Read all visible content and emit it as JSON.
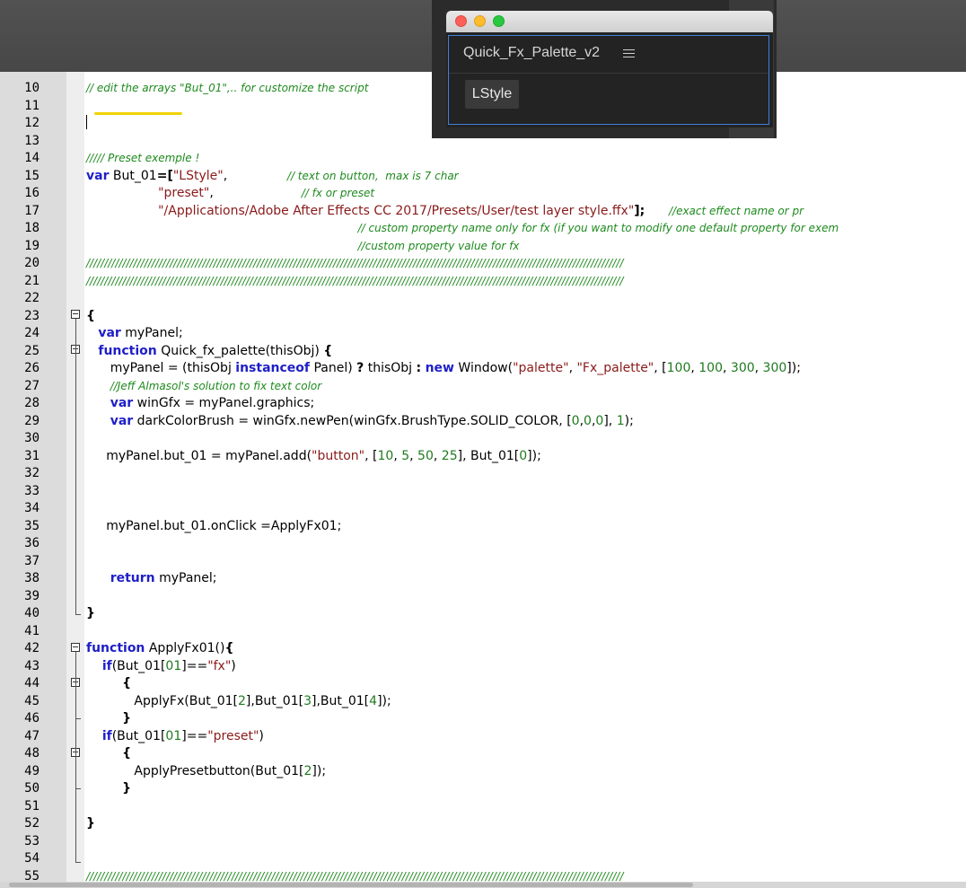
{
  "panel": {
    "title": "Quick_Fx_Palette_v2",
    "menu_icon": "hamburger-menu-icon",
    "button_label": "LStyle",
    "accent_color": "#3f80d8"
  },
  "editor": {
    "lines": [
      {
        "n": "10",
        "tokens": [
          {
            "t": "// edit the arrays \"But_01\",.. for customize the script",
            "c": "t-cm"
          }
        ]
      },
      {
        "n": "11",
        "tokens": []
      },
      {
        "n": "12",
        "tokens": []
      },
      {
        "n": "13",
        "tokens": []
      },
      {
        "n": "14",
        "tokens": [
          {
            "t": "///// Preset exemple !",
            "c": "t-cm"
          }
        ]
      },
      {
        "n": "15",
        "tokens": [
          {
            "t": "var",
            "c": "t-kw"
          },
          {
            "t": " But_01"
          },
          {
            "t": "=[",
            "c": "t-op"
          },
          {
            "t": "\"LStyle\"",
            "c": "t-str"
          },
          {
            "t": ",               "
          },
          {
            "t": "// text on button,  max is 7 char",
            "c": "t-cm"
          }
        ]
      },
      {
        "n": "16",
        "tokens": [
          {
            "t": "                  "
          },
          {
            "t": "\"preset\"",
            "c": "t-str"
          },
          {
            "t": ",                      "
          },
          {
            "t": "// fx or preset",
            "c": "t-cm"
          }
        ]
      },
      {
        "n": "17",
        "tokens": [
          {
            "t": "                  "
          },
          {
            "t": "\"/Applications/Adobe After Effects CC 2017/Presets/User/test layer style.ffx\"",
            "c": "t-str"
          },
          {
            "t": "];",
            "c": "t-op"
          },
          {
            "t": "      "
          },
          {
            "t": "//exact effect name or pr",
            "c": "t-cm"
          }
        ]
      },
      {
        "n": "18",
        "tokens": [
          {
            "t": "                                                                    "
          },
          {
            "t": "// custom property name only for fx (if you want to modify one default property for exem",
            "c": "t-cm"
          }
        ]
      },
      {
        "n": "19",
        "tokens": [
          {
            "t": "                                                                    "
          },
          {
            "t": "//custom property value for fx",
            "c": "t-cm"
          }
        ]
      },
      {
        "n": "20",
        "tokens": [
          {
            "t": "////////////////////////////////////////////////////////////////////////////////////////////////////////////////////////////////////////////////////",
            "c": "t-cm"
          }
        ]
      },
      {
        "n": "21",
        "tokens": [
          {
            "t": "////////////////////////////////////////////////////////////////////////////////////////////////////////////////////////////////////////////////////",
            "c": "t-cm"
          }
        ]
      },
      {
        "n": "22",
        "tokens": []
      },
      {
        "n": "23",
        "tokens": [
          {
            "t": "{",
            "c": "t-op"
          }
        ]
      },
      {
        "n": "24",
        "tokens": [
          {
            "t": "   "
          },
          {
            "t": "var",
            "c": "t-kw"
          },
          {
            "t": " myPanel;"
          }
        ]
      },
      {
        "n": "25",
        "tokens": [
          {
            "t": "   "
          },
          {
            "t": "function",
            "c": "t-kw"
          },
          {
            "t": " Quick_fx_palette(thisObj) "
          },
          {
            "t": "{",
            "c": "t-op"
          }
        ]
      },
      {
        "n": "26",
        "tokens": [
          {
            "t": "      myPanel = (thisObj "
          },
          {
            "t": "instanceof",
            "c": "t-kw"
          },
          {
            "t": " Panel) "
          },
          {
            "t": "?",
            "c": "t-op"
          },
          {
            "t": " thisObj "
          },
          {
            "t": ":",
            "c": "t-op"
          },
          {
            "t": " "
          },
          {
            "t": "new",
            "c": "t-kw"
          },
          {
            "t": " Window("
          },
          {
            "t": "\"palette\"",
            "c": "t-str"
          },
          {
            "t": ", "
          },
          {
            "t": "\"Fx_palette\"",
            "c": "t-str"
          },
          {
            "t": ", ["
          },
          {
            "t": "100",
            "c": "t-num"
          },
          {
            "t": ", "
          },
          {
            "t": "100",
            "c": "t-num"
          },
          {
            "t": ", "
          },
          {
            "t": "300",
            "c": "t-num"
          },
          {
            "t": ", "
          },
          {
            "t": "300",
            "c": "t-num"
          },
          {
            "t": "]);"
          }
        ]
      },
      {
        "n": "27",
        "tokens": [
          {
            "t": "      "
          },
          {
            "t": "//Jeff Almasol's solution to fix text color",
            "c": "t-cm"
          }
        ]
      },
      {
        "n": "28",
        "tokens": [
          {
            "t": "      "
          },
          {
            "t": "var",
            "c": "t-kw"
          },
          {
            "t": " winGfx = myPanel.graphics;"
          }
        ]
      },
      {
        "n": "29",
        "tokens": [
          {
            "t": "      "
          },
          {
            "t": "var",
            "c": "t-kw"
          },
          {
            "t": " darkColorBrush = winGfx.newPen(winGfx.BrushType.SOLID_COLOR, ["
          },
          {
            "t": "0",
            "c": "t-num"
          },
          {
            "t": ","
          },
          {
            "t": "0",
            "c": "t-num"
          },
          {
            "t": ","
          },
          {
            "t": "0",
            "c": "t-num"
          },
          {
            "t": "], "
          },
          {
            "t": "1",
            "c": "t-num"
          },
          {
            "t": ");"
          }
        ]
      },
      {
        "n": "30",
        "tokens": []
      },
      {
        "n": "31",
        "tokens": [
          {
            "t": "     myPanel.but_01 = myPanel.add("
          },
          {
            "t": "\"button\"",
            "c": "t-str"
          },
          {
            "t": ", ["
          },
          {
            "t": "10",
            "c": "t-num"
          },
          {
            "t": ", "
          },
          {
            "t": "5",
            "c": "t-num"
          },
          {
            "t": ", "
          },
          {
            "t": "50",
            "c": "t-num"
          },
          {
            "t": ", "
          },
          {
            "t": "25",
            "c": "t-num"
          },
          {
            "t": "], But_01["
          },
          {
            "t": "0",
            "c": "t-num"
          },
          {
            "t": "]);"
          }
        ]
      },
      {
        "n": "32",
        "tokens": []
      },
      {
        "n": "33",
        "tokens": []
      },
      {
        "n": "34",
        "tokens": []
      },
      {
        "n": "35",
        "tokens": [
          {
            "t": "     myPanel.but_01.onClick =ApplyFx01;"
          }
        ]
      },
      {
        "n": "36",
        "tokens": []
      },
      {
        "n": "37",
        "tokens": []
      },
      {
        "n": "38",
        "tokens": [
          {
            "t": "      "
          },
          {
            "t": "return",
            "c": "t-kw"
          },
          {
            "t": " myPanel;"
          }
        ]
      },
      {
        "n": "39",
        "tokens": []
      },
      {
        "n": "40",
        "tokens": [
          {
            "t": "}",
            "c": "t-op"
          }
        ]
      },
      {
        "n": "41",
        "tokens": []
      },
      {
        "n": "42",
        "tokens": [
          {
            "t": "function",
            "c": "t-kw"
          },
          {
            "t": " ApplyFx01()"
          },
          {
            "t": "{",
            "c": "t-op"
          }
        ]
      },
      {
        "n": "43",
        "tokens": [
          {
            "t": "    "
          },
          {
            "t": "if",
            "c": "t-kw"
          },
          {
            "t": "(But_01["
          },
          {
            "t": "01",
            "c": "t-num"
          },
          {
            "t": "]=="
          },
          {
            "t": "\"fx\"",
            "c": "t-str"
          },
          {
            "t": ")"
          }
        ]
      },
      {
        "n": "44",
        "tokens": [
          {
            "t": "         "
          },
          {
            "t": "{",
            "c": "t-op"
          }
        ]
      },
      {
        "n": "45",
        "tokens": [
          {
            "t": "            ApplyFx(But_01["
          },
          {
            "t": "2",
            "c": "t-num"
          },
          {
            "t": "],But_01["
          },
          {
            "t": "3",
            "c": "t-num"
          },
          {
            "t": "],But_01["
          },
          {
            "t": "4",
            "c": "t-num"
          },
          {
            "t": "]);"
          }
        ]
      },
      {
        "n": "46",
        "tokens": [
          {
            "t": "         "
          },
          {
            "t": "}",
            "c": "t-op"
          }
        ]
      },
      {
        "n": "47",
        "tokens": [
          {
            "t": "    "
          },
          {
            "t": "if",
            "c": "t-kw"
          },
          {
            "t": "(But_01["
          },
          {
            "t": "01",
            "c": "t-num"
          },
          {
            "t": "]=="
          },
          {
            "t": "\"preset\"",
            "c": "t-str"
          },
          {
            "t": ")"
          }
        ]
      },
      {
        "n": "48",
        "tokens": [
          {
            "t": "         "
          },
          {
            "t": "{",
            "c": "t-op"
          }
        ]
      },
      {
        "n": "49",
        "tokens": [
          {
            "t": "            ApplyPresetbutton(But_01["
          },
          {
            "t": "2",
            "c": "t-num"
          },
          {
            "t": "]);"
          }
        ]
      },
      {
        "n": "50",
        "tokens": [
          {
            "t": "         "
          },
          {
            "t": "}",
            "c": "t-op"
          }
        ]
      },
      {
        "n": "51",
        "tokens": []
      },
      {
        "n": "52",
        "tokens": [
          {
            "t": "}",
            "c": "t-op"
          }
        ]
      },
      {
        "n": "53",
        "tokens": []
      },
      {
        "n": "54",
        "tokens": []
      },
      {
        "n": "55",
        "tokens": [
          {
            "t": "////////////////////////////////////////////////////////////////////////////////////////////////////////////////////////////////////////////////////",
            "c": "t-cm"
          }
        ]
      }
    ]
  }
}
